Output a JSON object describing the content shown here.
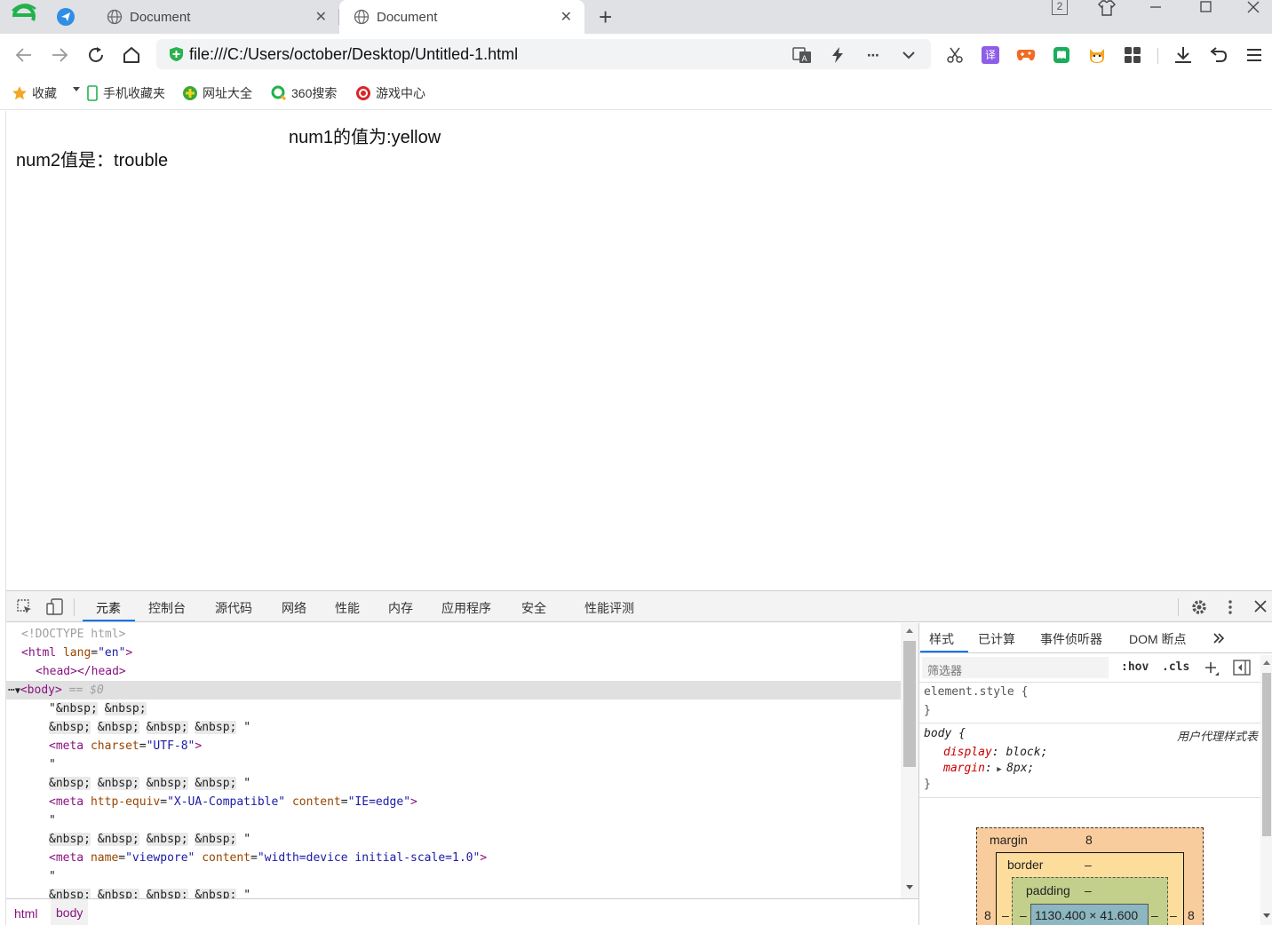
{
  "browser": {
    "tabs": [
      {
        "title": "Document"
      },
      {
        "title": "Document"
      }
    ],
    "tab_count_badge": "2",
    "address": "file:///C:/Users/october/Desktop/Untitled-1.html",
    "bookmarks": [
      {
        "label": "收藏"
      },
      {
        "label": "手机收藏夹"
      },
      {
        "label": "网址大全"
      },
      {
        "label": "360搜索"
      },
      {
        "label": "游戏中心"
      }
    ],
    "toolbar_translate_badge": "译"
  },
  "page": {
    "num1_text": "num1的值为:yellow",
    "num2_text": "num2值是：trouble"
  },
  "devtools": {
    "tabs": [
      "元素",
      "控制台",
      "源代码",
      "网络",
      "性能",
      "内存",
      "应用程序",
      "安全",
      "性能评测"
    ],
    "active_tab": "元素",
    "dom": {
      "doctype": "<!DOCTYPE html>",
      "html_open": "<html",
      "lang_attr": "lang",
      "lang_val": "\"en\"",
      "head": "<head></head>",
      "body_open": "<body>",
      "body_eq": "== $0",
      "quote": "\"",
      "nbsp": "&nbsp;",
      "meta": "<meta",
      "charset_attr": "charset",
      "charset_val": "\"UTF-8\"",
      "httpequiv_attr": "http-equiv",
      "httpequiv_val": "\"X-UA-Compatible\"",
      "content_attr": "content",
      "content_val_ie": "\"IE=edge\"",
      "name_attr": "name",
      "name_val": "\"viewpore\"",
      "content_val_vp": "\"width=device initial-scale=1.0\"",
      "close_bracket": ">"
    },
    "breadcrumb": [
      "html",
      "body"
    ],
    "styles": {
      "tabs": [
        "样式",
        "已计算",
        "事件侦听器",
        "DOM 断点"
      ],
      "filter_placeholder": "筛选器",
      "hov": ":hov",
      "cls": ".cls",
      "element_style": "element.style {",
      "close_brace": "}",
      "body_selector": "body {",
      "ua_label": "用户代理样式表",
      "prop_display": "display",
      "val_display": "block;",
      "prop_margin": "margin",
      "val_margin": "8px;"
    },
    "box_model": {
      "margin_label": "margin",
      "margin_value": "8",
      "margin_left": "8",
      "margin_right": "8",
      "border_label": "border",
      "border_value": "–",
      "padding_label": "padding",
      "padding_value": "–",
      "content_size": "1130.400 × 41.600",
      "dash": "–"
    }
  }
}
